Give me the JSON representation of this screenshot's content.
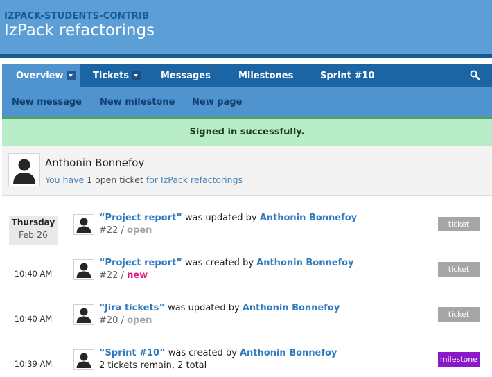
{
  "header": {
    "account": "IZPACK-STUDENTS-CONTRIB",
    "project": "IzPack refactorings"
  },
  "nav": {
    "tabs": [
      {
        "label": "Overview"
      },
      {
        "label": "Tickets"
      },
      {
        "label": "Messages"
      },
      {
        "label": "Milestones"
      },
      {
        "label": "Sprint #10"
      }
    ],
    "active_tab": "Overview",
    "sub": [
      {
        "label": "New message"
      },
      {
        "label": "New milestone"
      },
      {
        "label": "New page"
      }
    ]
  },
  "flash": "Signed in successfully.",
  "user": {
    "name": "Anthonin Bonnefoy",
    "prefix": "You have ",
    "link": "1 open ticket",
    "suffix": " for IzPack refactorings"
  },
  "activity": {
    "day": "Thursday",
    "date": "Feb 26",
    "entries": [
      {
        "time": "",
        "title": "“Project report”",
        "verb": " was updated by ",
        "who": "Anthonin Bonnefoy",
        "num": "#22 / ",
        "status": "open",
        "tag": "ticket"
      },
      {
        "time": "10:40 AM",
        "title": "“Project report”",
        "verb": " was created by ",
        "who": "Anthonin Bonnefoy",
        "num": "#22 / ",
        "status": "new",
        "tag": "ticket"
      },
      {
        "time": "10:40 AM",
        "title": "“Jira tickets”",
        "verb": " was updated by ",
        "who": "Anthonin Bonnefoy",
        "num": "#20 / ",
        "status": "open",
        "tag": "ticket"
      },
      {
        "time": "10:39 AM",
        "title": "“Sprint #10”",
        "verb": " was created by ",
        "who": "Anthonin Bonnefoy",
        "num": "",
        "status": "2 tickets remain, 2 total",
        "tag": "milestone"
      }
    ]
  },
  "colors": {
    "header_bg": "#5b9fd6",
    "nav_bg": "#1c65a5",
    "flash_bg": "#b9ecc9",
    "link": "#2f7bbd",
    "status_new": "#e4157a",
    "tag_ticket": "#a6a6a6",
    "tag_milestone": "#8b19c8"
  }
}
